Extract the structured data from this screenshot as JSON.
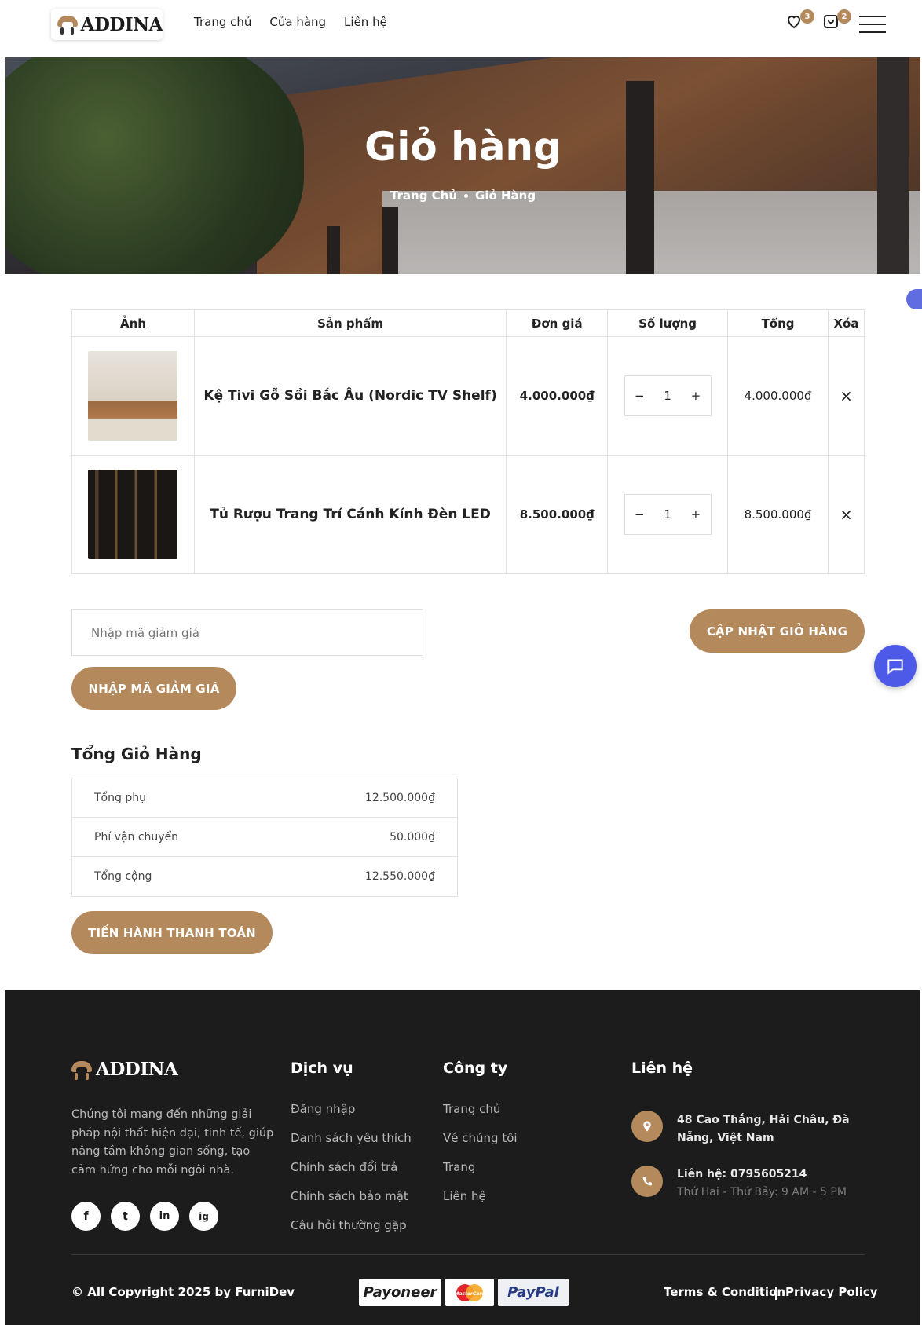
{
  "header": {
    "logo_text": "ADDINA",
    "nav": [
      "Trang chủ",
      "Cửa hàng",
      "Liên hệ"
    ],
    "wishlist_count": "3",
    "cart_count": "2"
  },
  "hero": {
    "title": "Giỏ hàng",
    "breadcrumb": [
      "Trang Chủ",
      "Giỏ Hàng"
    ]
  },
  "cart": {
    "columns": [
      "Ảnh",
      "Sản phẩm",
      "Đơn giá",
      "Số lượng",
      "Tổng",
      "Xóa"
    ],
    "items": [
      {
        "name": "Kệ Tivi Gỗ Sồi Bắc Âu (Nordic TV Shelf)",
        "price": "4.000.000₫",
        "qty": "1",
        "total": "4.000.000₫",
        "remove": "×"
      },
      {
        "name": "Tủ Rượu Trang Trí Cánh Kính Đèn LED",
        "price": "8.500.000₫",
        "qty": "1",
        "total": "8.500.000₫",
        "remove": "×"
      }
    ],
    "qty_minus": "−",
    "qty_plus": "+"
  },
  "coupon": {
    "placeholder": "Nhập mã giảm giá",
    "apply_label": "NHẬP MÃ GIẢM GIÁ",
    "update_label": "CẬP NHẬT GIỎ HÀNG"
  },
  "totals": {
    "title": "Tổng Giỏ Hàng",
    "rows": [
      {
        "label": "Tổng phụ",
        "value": "12.500.000₫"
      },
      {
        "label": "Phí vận chuyển",
        "value": "50.000₫"
      },
      {
        "label": "Tổng cộng",
        "value": "12.550.000₫"
      }
    ],
    "checkout_label": "TIẾN HÀNH THANH TOÁN"
  },
  "footer": {
    "logo_text": "ADDINA",
    "description": "Chúng tôi mang đến những giải pháp nội thất hiện đại, tinh tế, giúp nâng tầm không gian sống, tạo cảm hứng cho mỗi ngôi nhà.",
    "social": [
      "f",
      "t",
      "in",
      "ig"
    ],
    "services_title": "Dịch vụ",
    "services": [
      "Đăng nhập",
      "Danh sách yêu thích",
      "Chính sách đổi trả",
      "Chính sách bảo mật",
      "Câu hỏi thường gặp"
    ],
    "company_title": "Công ty",
    "company": [
      "Trang chủ",
      "Về chúng tôi",
      "Trang",
      "Liên hệ"
    ],
    "contact_title": "Liên hệ",
    "address": "48 Cao Thắng, Hải Châu, Đà Nẵng, Việt Nam",
    "phone": "Liên hệ: 0795605214",
    "hours": "Thứ Hai - Thứ Bảy: 9 AM - 5 PM",
    "copyright": "© All Copyright 2025 by FurniDev",
    "payments": [
      "Payoneer",
      "MasterCard",
      "PayPal"
    ],
    "terms": "Terms & Condition",
    "privacy": "Privacy Policy"
  },
  "colors": {
    "accent": "#b48a5d",
    "footer_bg": "#1c1c1c",
    "chat": "#4d5ae8"
  }
}
